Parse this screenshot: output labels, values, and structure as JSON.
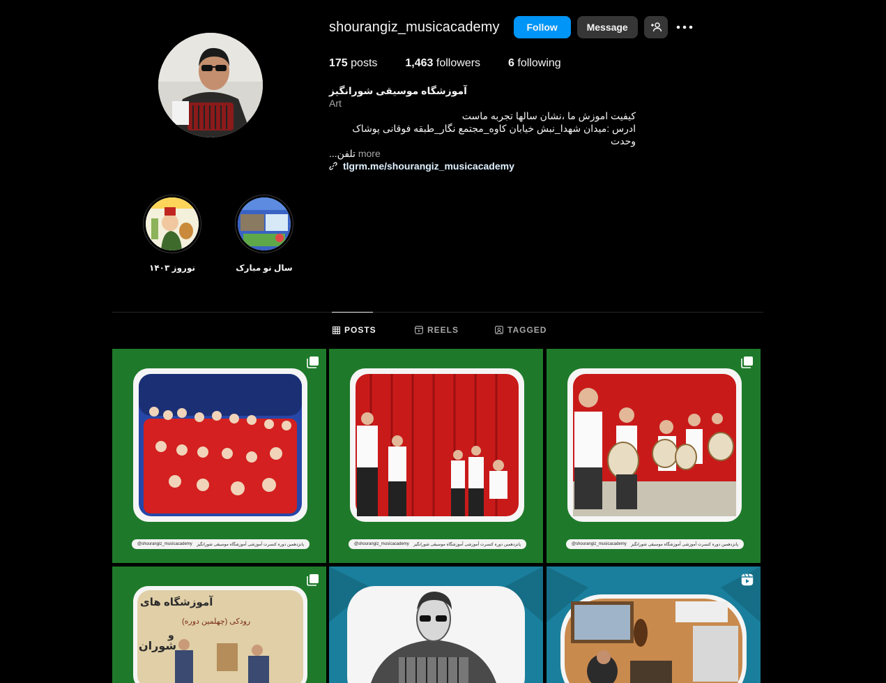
{
  "profile": {
    "username": "shourangiz_musicacademy",
    "follow_label": "Follow",
    "message_label": "Message",
    "posts_count": "175",
    "posts_label": "posts",
    "followers_count": "1,463",
    "followers_label": "followers",
    "following_count": "6",
    "following_label": "following"
  },
  "bio": {
    "name": "آموزشگاه موسیقی شورانگیز",
    "category": "Art",
    "line1": "کیفیت اموزش ما ،نشان سالها تجربه ماست",
    "line2": "ادرس :میدان شهدا_نبش خیابان کاوه_مجتمع نگار_طبقه فوقانی پوشاک وحدت",
    "line3": "تلفن...",
    "more_label": "more",
    "link": "tlgrm.me/shourangiz_musicacademy"
  },
  "highlights": [
    {
      "label": "نوروز ۱۴۰۳"
    },
    {
      "label": "سال نو مبارک"
    }
  ],
  "tabs": {
    "posts": "POSTS",
    "reels": "REELS",
    "tagged": "TAGGED"
  },
  "posts": [
    {
      "caption_left": "@shourangiz_musicacademy",
      "caption_right": "پانزدهمین دوره کنسرت آموزشی آموزشگاه موسیقی شورانگیز",
      "badge": "carousel-icon"
    },
    {
      "caption_left": "@shourangiz_musicacademy",
      "caption_right": "پانزدهمین دوره کنسرت آموزشی آموزشگاه موسیقی شورانگیز",
      "badge": ""
    },
    {
      "caption_left": "@shourangiz_musicacademy",
      "caption_right": "پانزدهمین دوره کنسرت آموزشی آموزشگاه موسیقی شورانگیز",
      "badge": "carousel-icon"
    },
    {
      "poster_title": "آموزشگاه های",
      "poster_sub": "رودکی (چهلمین دوره)",
      "poster_and": "و",
      "poster_name": "شوران",
      "badge": "carousel-icon"
    },
    {
      "badge": ""
    },
    {
      "badge": "reel-icon"
    }
  ],
  "colors": {
    "accent": "#0095f6",
    "button_dark": "#363636",
    "post_green": "#1e7a2a",
    "post_teal": "#1a7f9c"
  }
}
